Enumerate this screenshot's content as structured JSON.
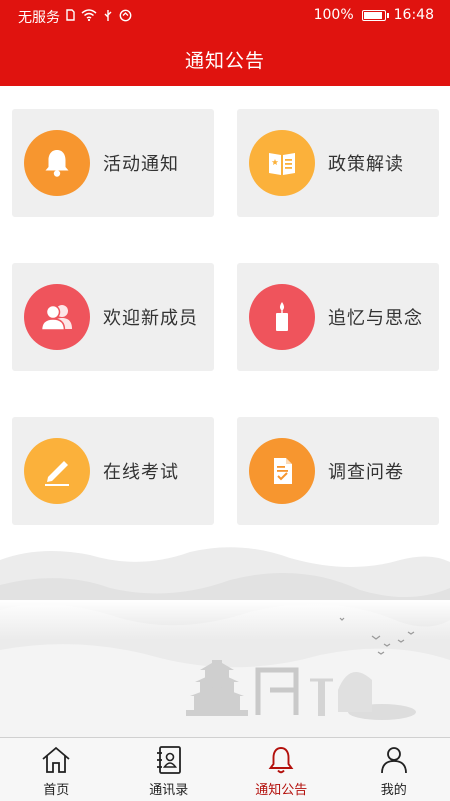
{
  "status_bar": {
    "carrier": "无服务",
    "battery": "100%",
    "time": "16:48"
  },
  "header": {
    "title": "通知公告"
  },
  "grid": {
    "items": [
      {
        "label": "活动通知",
        "icon": "bell-icon",
        "color": "#f7962f"
      },
      {
        "label": "政策解读",
        "icon": "book-star-icon",
        "color": "#fbb13b"
      },
      {
        "label": "欢迎新成员",
        "icon": "users-icon",
        "color": "#ef545c"
      },
      {
        "label": "追忆与思念",
        "icon": "candle-icon",
        "color": "#ef545c"
      },
      {
        "label": "在线考试",
        "icon": "pen-icon",
        "color": "#fbb13b"
      },
      {
        "label": "调查问卷",
        "icon": "document-check-icon",
        "color": "#f7962f"
      }
    ]
  },
  "tabbar": {
    "tabs": [
      {
        "label": "首页",
        "icon": "home-icon"
      },
      {
        "label": "通讯录",
        "icon": "contacts-icon"
      },
      {
        "label": "通知公告",
        "icon": "bell-icon"
      },
      {
        "label": "我的",
        "icon": "profile-icon"
      }
    ],
    "active_index": 2,
    "active_color": "#b3100c"
  },
  "colors": {
    "primary": "#e0130f"
  }
}
